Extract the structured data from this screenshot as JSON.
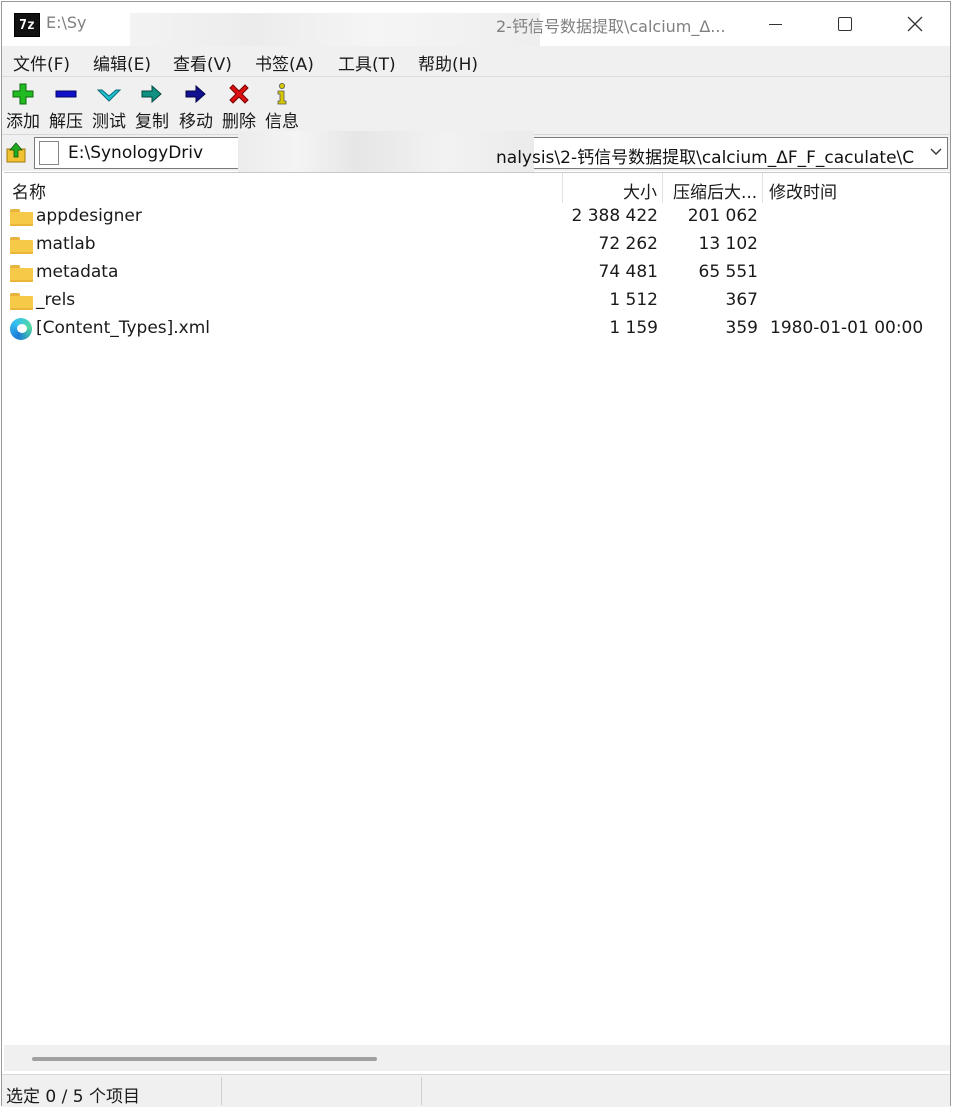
{
  "window": {
    "title_start": "E:\\Sy",
    "title_end": "2-钙信号数据提取\\calcium_Δ...",
    "app_icon_text": "7z"
  },
  "menu": [
    "文件(F)",
    "编辑(E)",
    "查看(V)",
    "书签(A)",
    "工具(T)",
    "帮助(H)"
  ],
  "toolbar": [
    {
      "label": "添加",
      "icon": "plus-icon",
      "color": "#22bb22"
    },
    {
      "label": "解压",
      "icon": "minus-icon",
      "color": "#1010c8"
    },
    {
      "label": "测试",
      "icon": "check-icon",
      "color": "#20c0d0"
    },
    {
      "label": "复制",
      "icon": "copy-arrow-icon",
      "color": "#109080"
    },
    {
      "label": "移动",
      "icon": "move-arrow-icon",
      "color": "#101090"
    },
    {
      "label": "删除",
      "icon": "delete-icon",
      "color": "#dd1111"
    },
    {
      "label": "信息",
      "icon": "info-icon",
      "color": "#d8c800"
    }
  ],
  "address": {
    "path_start": "E:\\SynologyDriv",
    "path_end": "nalysis\\2-钙信号数据提取\\calcium_ΔF_F_caculate\\C"
  },
  "columns": {
    "name": "名称",
    "size": "大小",
    "packed": "压缩后大...",
    "modified": "修改时间"
  },
  "files": [
    {
      "name": "appdesigner",
      "size": "2 388 422",
      "packed": "201 062",
      "modified": "",
      "type": "folder"
    },
    {
      "name": "matlab",
      "size": "72 262",
      "packed": "13 102",
      "modified": "",
      "type": "folder"
    },
    {
      "name": "metadata",
      "size": "74 481",
      "packed": "65 551",
      "modified": "",
      "type": "folder"
    },
    {
      "name": "_rels",
      "size": "1 512",
      "packed": "367",
      "modified": "",
      "type": "folder"
    },
    {
      "name": "[Content_Types].xml",
      "size": "1 159",
      "packed": "359",
      "modified": "1980-01-01 00:00",
      "type": "xml"
    }
  ],
  "status": {
    "selection": "选定 0 / 5 个项目"
  }
}
